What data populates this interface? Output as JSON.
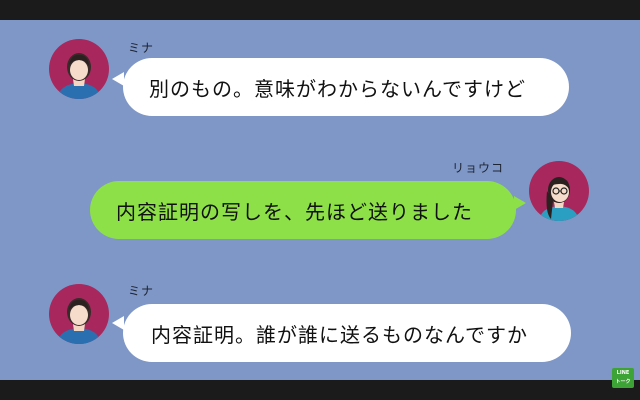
{
  "messages": [
    {
      "sender": "ミナ",
      "side": "left",
      "text": "別のもの。意味がわからないんですけど",
      "avatar_icon": "woman-short-hair-avatar-icon"
    },
    {
      "sender": "リョウコ",
      "side": "right",
      "text": "内容証明の写しを、先ほど送りました",
      "avatar_icon": "woman-glasses-avatar-icon"
    },
    {
      "sender": "ミナ",
      "side": "left",
      "text": "内容証明。誰が誰に送るものなんですか",
      "avatar_icon": "woman-short-hair-avatar-icon"
    }
  ],
  "logo": {
    "line1": "LINE",
    "line2": "トーク"
  },
  "colors": {
    "background": "#7f97c6",
    "bubble_left": "#ffffff",
    "bubble_right": "#8ee048",
    "avatar_bg": "#a8275c",
    "letterbox": "#1b1b1b"
  }
}
